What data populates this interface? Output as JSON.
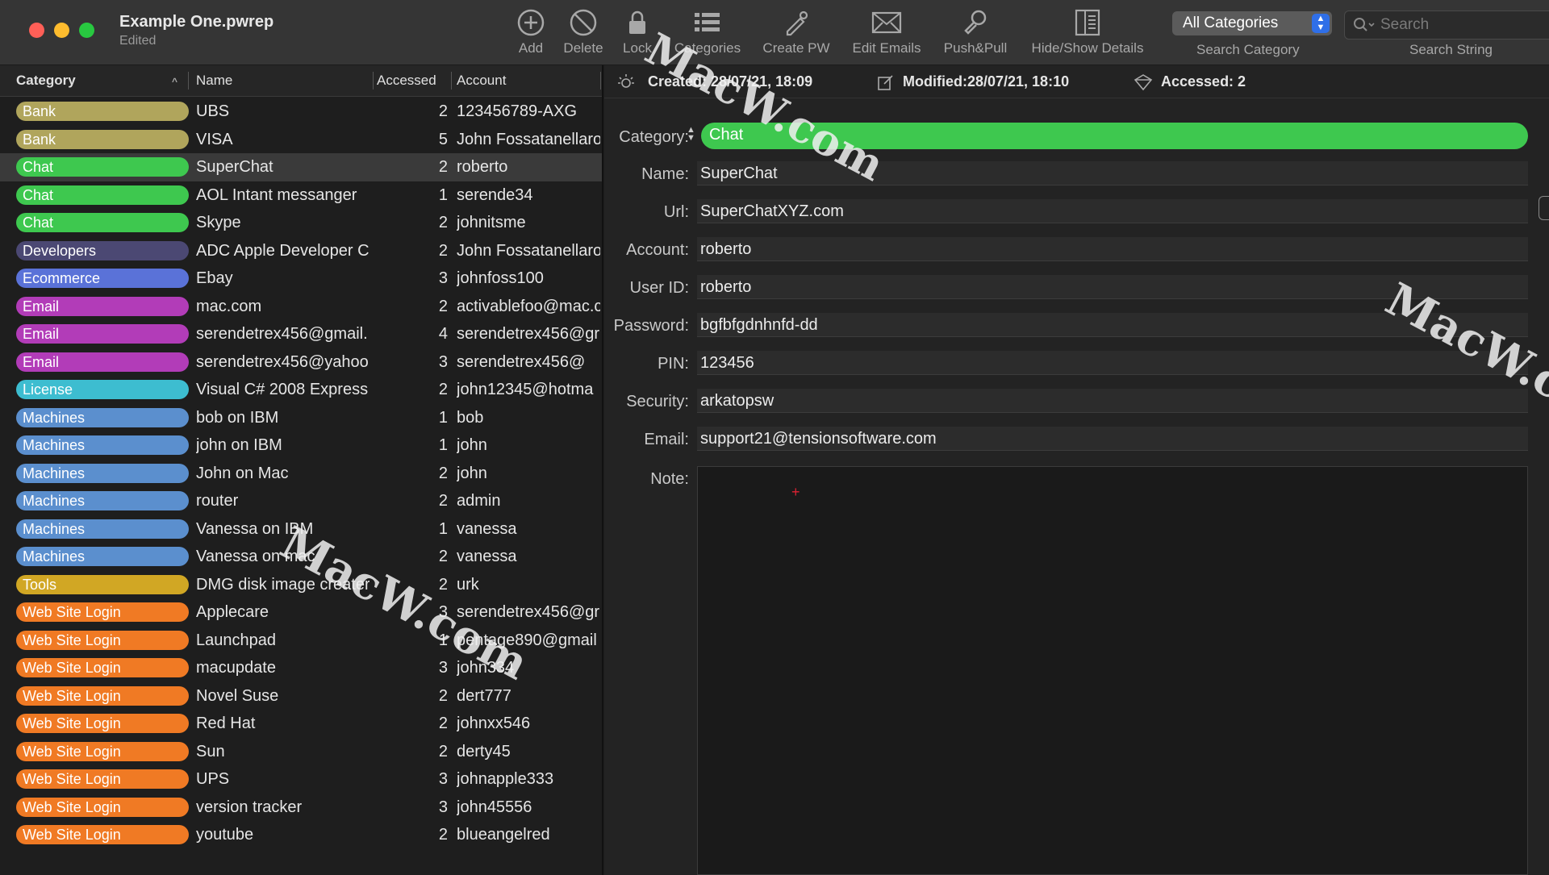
{
  "window": {
    "title": "Example One.pwrep",
    "subtitle": "Edited"
  },
  "toolbar": {
    "buttons": [
      {
        "label": "Add",
        "icon": "add-circle-icon"
      },
      {
        "label": "Delete",
        "icon": "delete-circle-icon"
      },
      {
        "label": "Lock",
        "icon": "lock-icon"
      },
      {
        "label": "Categories",
        "icon": "categories-icon"
      },
      {
        "label": "Create PW",
        "icon": "create-password-icon"
      },
      {
        "label": "Edit Emails",
        "icon": "envelope-icon"
      },
      {
        "label": "Push&Pull",
        "icon": "push-pull-icon"
      },
      {
        "label": "Hide/Show Details",
        "icon": "sidebar-icon"
      }
    ],
    "category_select": {
      "value": "All Categories",
      "caption": "Search Category"
    },
    "search": {
      "placeholder": "Search",
      "caption": "Search String"
    }
  },
  "list": {
    "columns": {
      "category": "Category",
      "name": "Name",
      "accessed": "Accessed",
      "account": "Account"
    },
    "rows": [
      {
        "category": "Bank",
        "color": "#b0a55c",
        "name": "UBS",
        "accessed": "2",
        "account": "123456789-AXG"
      },
      {
        "category": "Bank",
        "color": "#b0a55c",
        "name": "VISA",
        "accessed": "5",
        "account": "John Fossatanellaro"
      },
      {
        "category": "Chat",
        "color": "#3ec84f",
        "name": "SuperChat",
        "accessed": "2",
        "account": "roberto",
        "selected": true
      },
      {
        "category": "Chat",
        "color": "#3ec84f",
        "name": "AOL Intant messanger",
        "accessed": "1",
        "account": "serende34"
      },
      {
        "category": "Chat",
        "color": "#3ec84f",
        "name": "Skype",
        "accessed": "2",
        "account": "johnitsme"
      },
      {
        "category": "Developers",
        "color": "#4b4873",
        "name": "ADC Apple Developer C",
        "accessed": "2",
        "account": "John Fossatanellaro"
      },
      {
        "category": "Ecommerce",
        "color": "#5a72d8",
        "name": "Ebay",
        "accessed": "3",
        "account": "johnfoss100"
      },
      {
        "category": "Email",
        "color": "#b23cb8",
        "name": "mac.com",
        "accessed": "2",
        "account": "activablefoo@mac.c"
      },
      {
        "category": "Email",
        "color": "#b23cb8",
        "name": "serendetrex456@gmail.",
        "accessed": "4",
        "account": "serendetrex456@gr"
      },
      {
        "category": "Email",
        "color": "#b23cb8",
        "name": "serendetrex456@yahoo",
        "accessed": "3",
        "account": "serendetrex456@"
      },
      {
        "category": "License",
        "color": "#3dbdd0",
        "name": "Visual C# 2008 Express",
        "accessed": "2",
        "account": "john12345@hotma"
      },
      {
        "category": "Machines",
        "color": "#5b8fce",
        "name": "bob on IBM",
        "accessed": "1",
        "account": "bob"
      },
      {
        "category": "Machines",
        "color": "#5b8fce",
        "name": "john on IBM",
        "accessed": "1",
        "account": "john"
      },
      {
        "category": "Machines",
        "color": "#5b8fce",
        "name": "John on Mac",
        "accessed": "2",
        "account": "john"
      },
      {
        "category": "Machines",
        "color": "#5b8fce",
        "name": "router",
        "accessed": "2",
        "account": "admin"
      },
      {
        "category": "Machines",
        "color": "#5b8fce",
        "name": "Vanessa on IBM",
        "accessed": "1",
        "account": "vanessa"
      },
      {
        "category": "Machines",
        "color": "#5b8fce",
        "name": "Vanessa on mac",
        "accessed": "2",
        "account": "vanessa"
      },
      {
        "category": "Tools",
        "color": "#d1a724",
        "name": "DMG disk image creater",
        "accessed": "2",
        "account": "urk"
      },
      {
        "category": "Web Site Login",
        "color": "#f07a24",
        "name": "Applecare",
        "accessed": "3",
        "account": "serendetrex456@gr"
      },
      {
        "category": "Web Site Login",
        "color": "#f07a24",
        "name": "Launchpad",
        "accessed": "1",
        "account": "pentage890@gmail"
      },
      {
        "category": "Web Site Login",
        "color": "#f07a24",
        "name": "macupdate",
        "accessed": "3",
        "account": "john334"
      },
      {
        "category": "Web Site Login",
        "color": "#f07a24",
        "name": "Novel Suse",
        "accessed": "2",
        "account": "dert777"
      },
      {
        "category": "Web Site Login",
        "color": "#f07a24",
        "name": "Red Hat",
        "accessed": "2",
        "account": "johnxx546"
      },
      {
        "category": "Web Site Login",
        "color": "#f07a24",
        "name": "Sun",
        "accessed": "2",
        "account": "derty45"
      },
      {
        "category": "Web Site Login",
        "color": "#f07a24",
        "name": "UPS",
        "accessed": "3",
        "account": "johnapple333"
      },
      {
        "category": "Web Site Login",
        "color": "#f07a24",
        "name": "version tracker",
        "accessed": "3",
        "account": "john45556"
      },
      {
        "category": "Web Site Login",
        "color": "#f07a24",
        "name": "youtube",
        "accessed": "2",
        "account": "blueangelred"
      }
    ]
  },
  "detail": {
    "created": "Created: 28/07/21, 18:09",
    "modified": "Modified:28/07/21, 18:10",
    "accessed": "Accessed: 2",
    "category_label": "Category:",
    "category_value": "Chat",
    "category_color": "#3ec84f",
    "fields": [
      {
        "label": "Name:",
        "value": "SuperChat"
      },
      {
        "label": "Url:",
        "value": "SuperChatXYZ.com"
      },
      {
        "label": "Account:",
        "value": "roberto"
      },
      {
        "label": "User ID:",
        "value": "roberto"
      },
      {
        "label": "Password:",
        "value": "bgfbfgdnhnfd-dd"
      },
      {
        "label": "PIN:",
        "value": "123456"
      },
      {
        "label": "Security:",
        "value": "arkatopsw"
      },
      {
        "label": "Email:",
        "value": "support21@tensionsoftware.com"
      }
    ],
    "note_label": "Note:",
    "note_value": ""
  },
  "watermark": {
    "text": "MacW.com",
    "short": "MacW.c"
  }
}
